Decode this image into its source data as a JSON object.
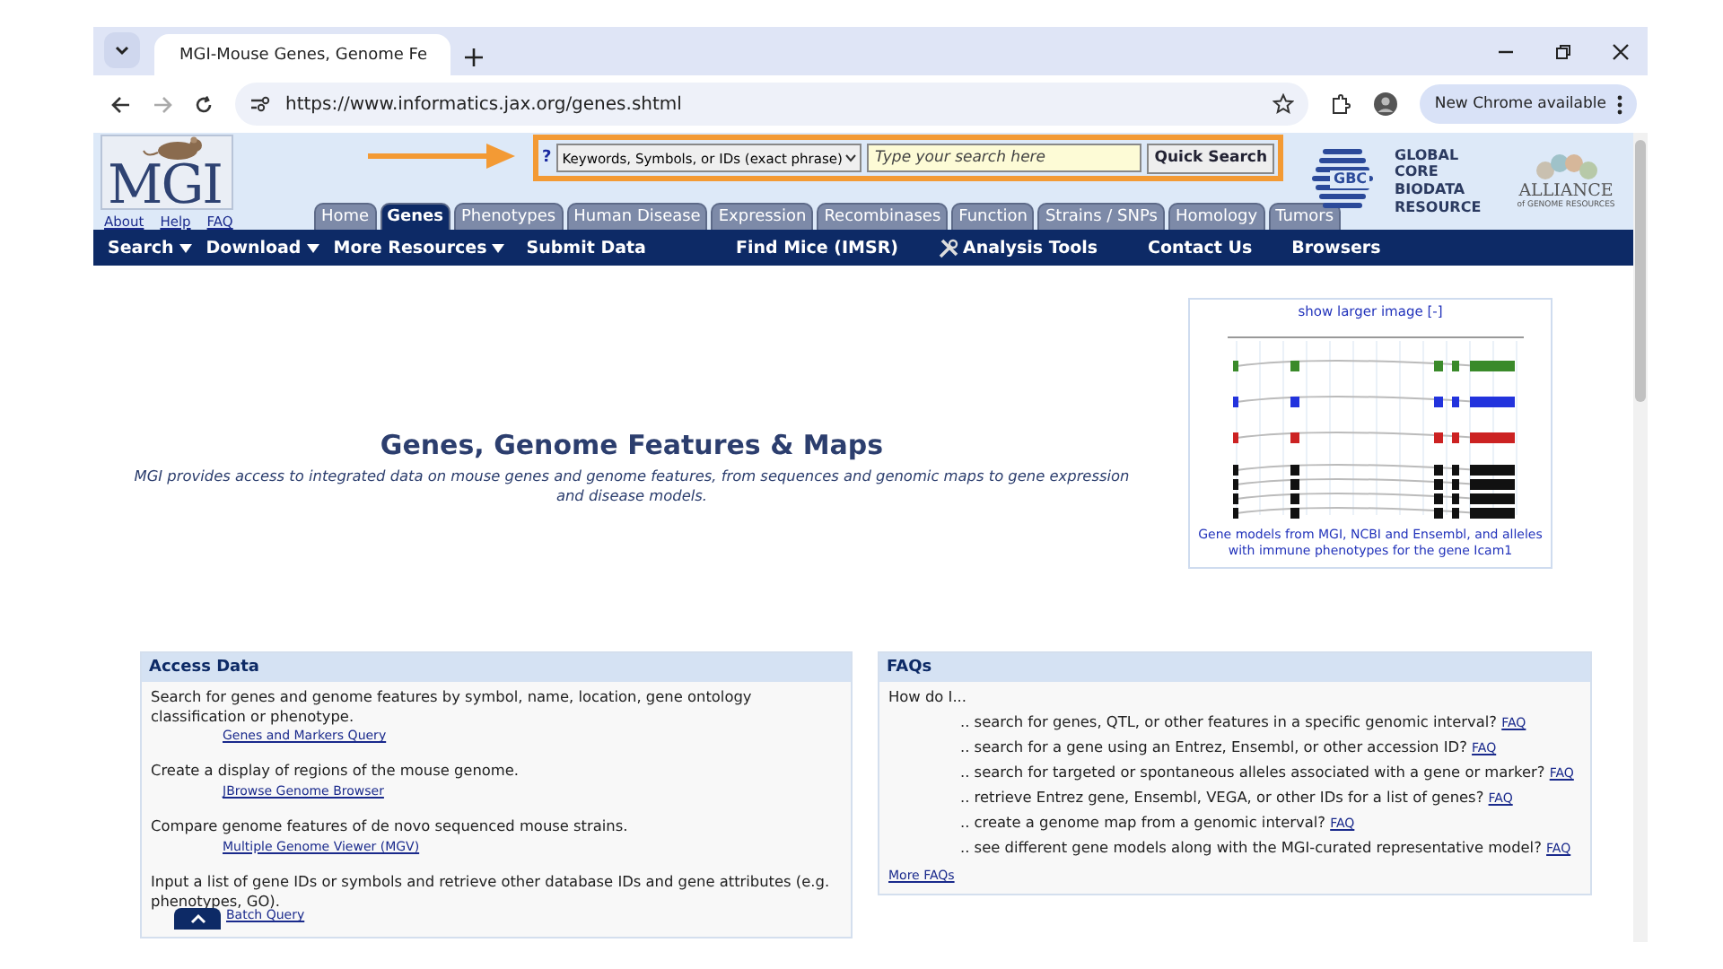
{
  "browser": {
    "tab_title": "MGI-Mouse Genes, Genome Fe",
    "url": "https://www.informatics.jax.org/genes.shtml",
    "update_button": "New Chrome available"
  },
  "header": {
    "logo": "MGI",
    "links": [
      "About",
      "Help",
      "FAQ"
    ],
    "search": {
      "help": "?",
      "scope": "Keywords, Symbols, or IDs (exact phrase)",
      "placeholder": "Type your search here",
      "button": "Quick Search"
    },
    "gbc": {
      "badge": "GBC",
      "lines": [
        "GLOBAL",
        "CORE",
        "BIODATA",
        "RESOURCE"
      ]
    },
    "alliance": {
      "name": "ALLIANCE",
      "sub": "of GENOME RESOURCES"
    }
  },
  "tabs": [
    {
      "label": "Home",
      "selected": false
    },
    {
      "label": "Genes",
      "selected": true
    },
    {
      "label": "Phenotypes",
      "selected": false
    },
    {
      "label": "Human Disease",
      "selected": false
    },
    {
      "label": "Expression",
      "selected": false
    },
    {
      "label": "Recombinases",
      "selected": false
    },
    {
      "label": "Function",
      "selected": false
    },
    {
      "label": "Strains / SNPs",
      "selected": false
    },
    {
      "label": "Homology",
      "selected": false
    },
    {
      "label": "Tumors",
      "selected": false
    }
  ],
  "menu": [
    {
      "label": "Search",
      "kind": "dropdown"
    },
    {
      "label": "Download",
      "kind": "dropdown"
    },
    {
      "label": "More Resources",
      "kind": "dropdown"
    },
    {
      "label": "Submit Data",
      "kind": "link"
    },
    {
      "label": "Find Mice (IMSR)",
      "kind": "link"
    },
    {
      "label": "Analysis Tools",
      "kind": "tools"
    },
    {
      "label": "Contact Us",
      "kind": "link"
    },
    {
      "label": "Browsers",
      "kind": "link"
    }
  ],
  "hero": {
    "title": "Genes, Genome Features & Maps",
    "subtitle": "MGI provides access to integrated data on mouse genes and genome features, from sequences and genomic maps to gene expression and disease models.",
    "figure": {
      "link": "show larger image [-]",
      "caption": "Gene models from MGI, NCBI and Ensembl, and alleles with immune phenotypes for the gene Icam1"
    }
  },
  "access_data": {
    "title": "Access Data",
    "items": [
      {
        "text": "Search for genes and genome features by symbol, name, location, gene ontology classification or phenotype.",
        "link": "Genes and Markers Query"
      },
      {
        "text": "Create a display of regions of the mouse genome.",
        "link": "JBrowse Genome Browser"
      },
      {
        "text": "Compare genome features of de novo sequenced mouse strains.",
        "link": "Multiple Genome Viewer (MGV)"
      },
      {
        "text": "Input a list of gene IDs or symbols and retrieve other database IDs and gene attributes (e.g. phenotypes, GO).",
        "link": "Batch Query"
      }
    ]
  },
  "faqs": {
    "title": "FAQs",
    "intro": "How do I...",
    "items": [
      {
        "text": ".. search for genes, QTL, or other features in a specific genomic interval?",
        "link": "FAQ"
      },
      {
        "text": ".. search for a gene using an Entrez, Ensembl, or other accession ID?",
        "link": "FAQ"
      },
      {
        "text": ".. search for targeted or spontaneous alleles associated with a gene or marker?",
        "link": "FAQ"
      },
      {
        "text": ".. retrieve Entrez gene, Ensembl, VEGA, or other IDs for a list of genes?",
        "link": "FAQ"
      },
      {
        "text": ".. create a genome map from a genomic interval?",
        "link": "FAQ"
      },
      {
        "text": ".. see different gene models along with the MGI-curated representative model?",
        "link": "FAQ"
      }
    ],
    "more": "More FAQs"
  }
}
